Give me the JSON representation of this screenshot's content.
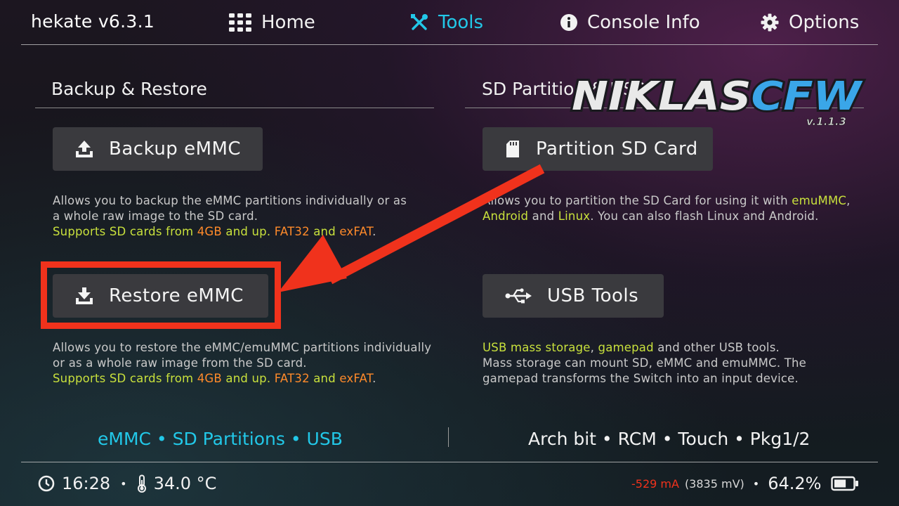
{
  "header": {
    "title": "hekate v6.3.1",
    "nav": [
      {
        "label": "Home",
        "icon": "grid-icon",
        "active": false
      },
      {
        "label": "Tools",
        "icon": "wrench-screwdriver-icon",
        "active": true
      },
      {
        "label": "Console Info",
        "icon": "info-icon",
        "active": false
      },
      {
        "label": "Options",
        "icon": "gear-icon",
        "active": false
      }
    ]
  },
  "watermark": {
    "logo": "NIKLASCFW",
    "version": "v.1.1.3"
  },
  "left": {
    "title": "Backup & Restore",
    "backup": {
      "label": "Backup eMMC",
      "desc1": "Allows you to backup the eMMC partitions individually or as",
      "desc2": "a whole raw image to the SD card.",
      "note": [
        "Supports SD cards from ",
        "4GB",
        " and up. ",
        "FAT32",
        " and ",
        "exFAT",
        "."
      ]
    },
    "restore": {
      "label": "Restore eMMC",
      "desc1": "Allows you to restore the eMMC/emuMMC partitions individually",
      "desc2": "or as a whole raw image from the SD card.",
      "note": [
        "Supports SD cards from ",
        "4GB",
        " and up. ",
        "FAT32",
        " and ",
        "exFAT",
        "."
      ]
    }
  },
  "right": {
    "title": "SD Partition & USB",
    "partition": {
      "label": "Partition SD Card",
      "desc1": [
        "Allows you to partition the SD Card for using it with ",
        "emuMMC",
        ","
      ],
      "desc2": [
        "Android",
        " and ",
        "Linux",
        ". You can also flash Linux and Android."
      ]
    },
    "usb": {
      "label": "USB Tools",
      "desc1": [
        "USB mass storage",
        ", ",
        "gamepad",
        " and other USB tools."
      ],
      "desc2": "Mass storage can mount SD, eMMC and emuMMC. The",
      "desc3": "gamepad transforms the Switch into an input device."
    }
  },
  "footer": {
    "left_categories": "eMMC • SD Partitions • USB",
    "right_categories": "Arch bit • RCM • Touch • Pkg1/2"
  },
  "status": {
    "time": "16:28",
    "separator": "•",
    "temperature": "34.0 °C",
    "current": "-529 mA",
    "voltage": "(3835 mV)",
    "battery": "64.2%"
  },
  "colors": {
    "accent": "#22c8e8",
    "highlight": "#f0321c",
    "note_yellow": "#c8e03c",
    "note_orange": "#ff8a2a"
  }
}
